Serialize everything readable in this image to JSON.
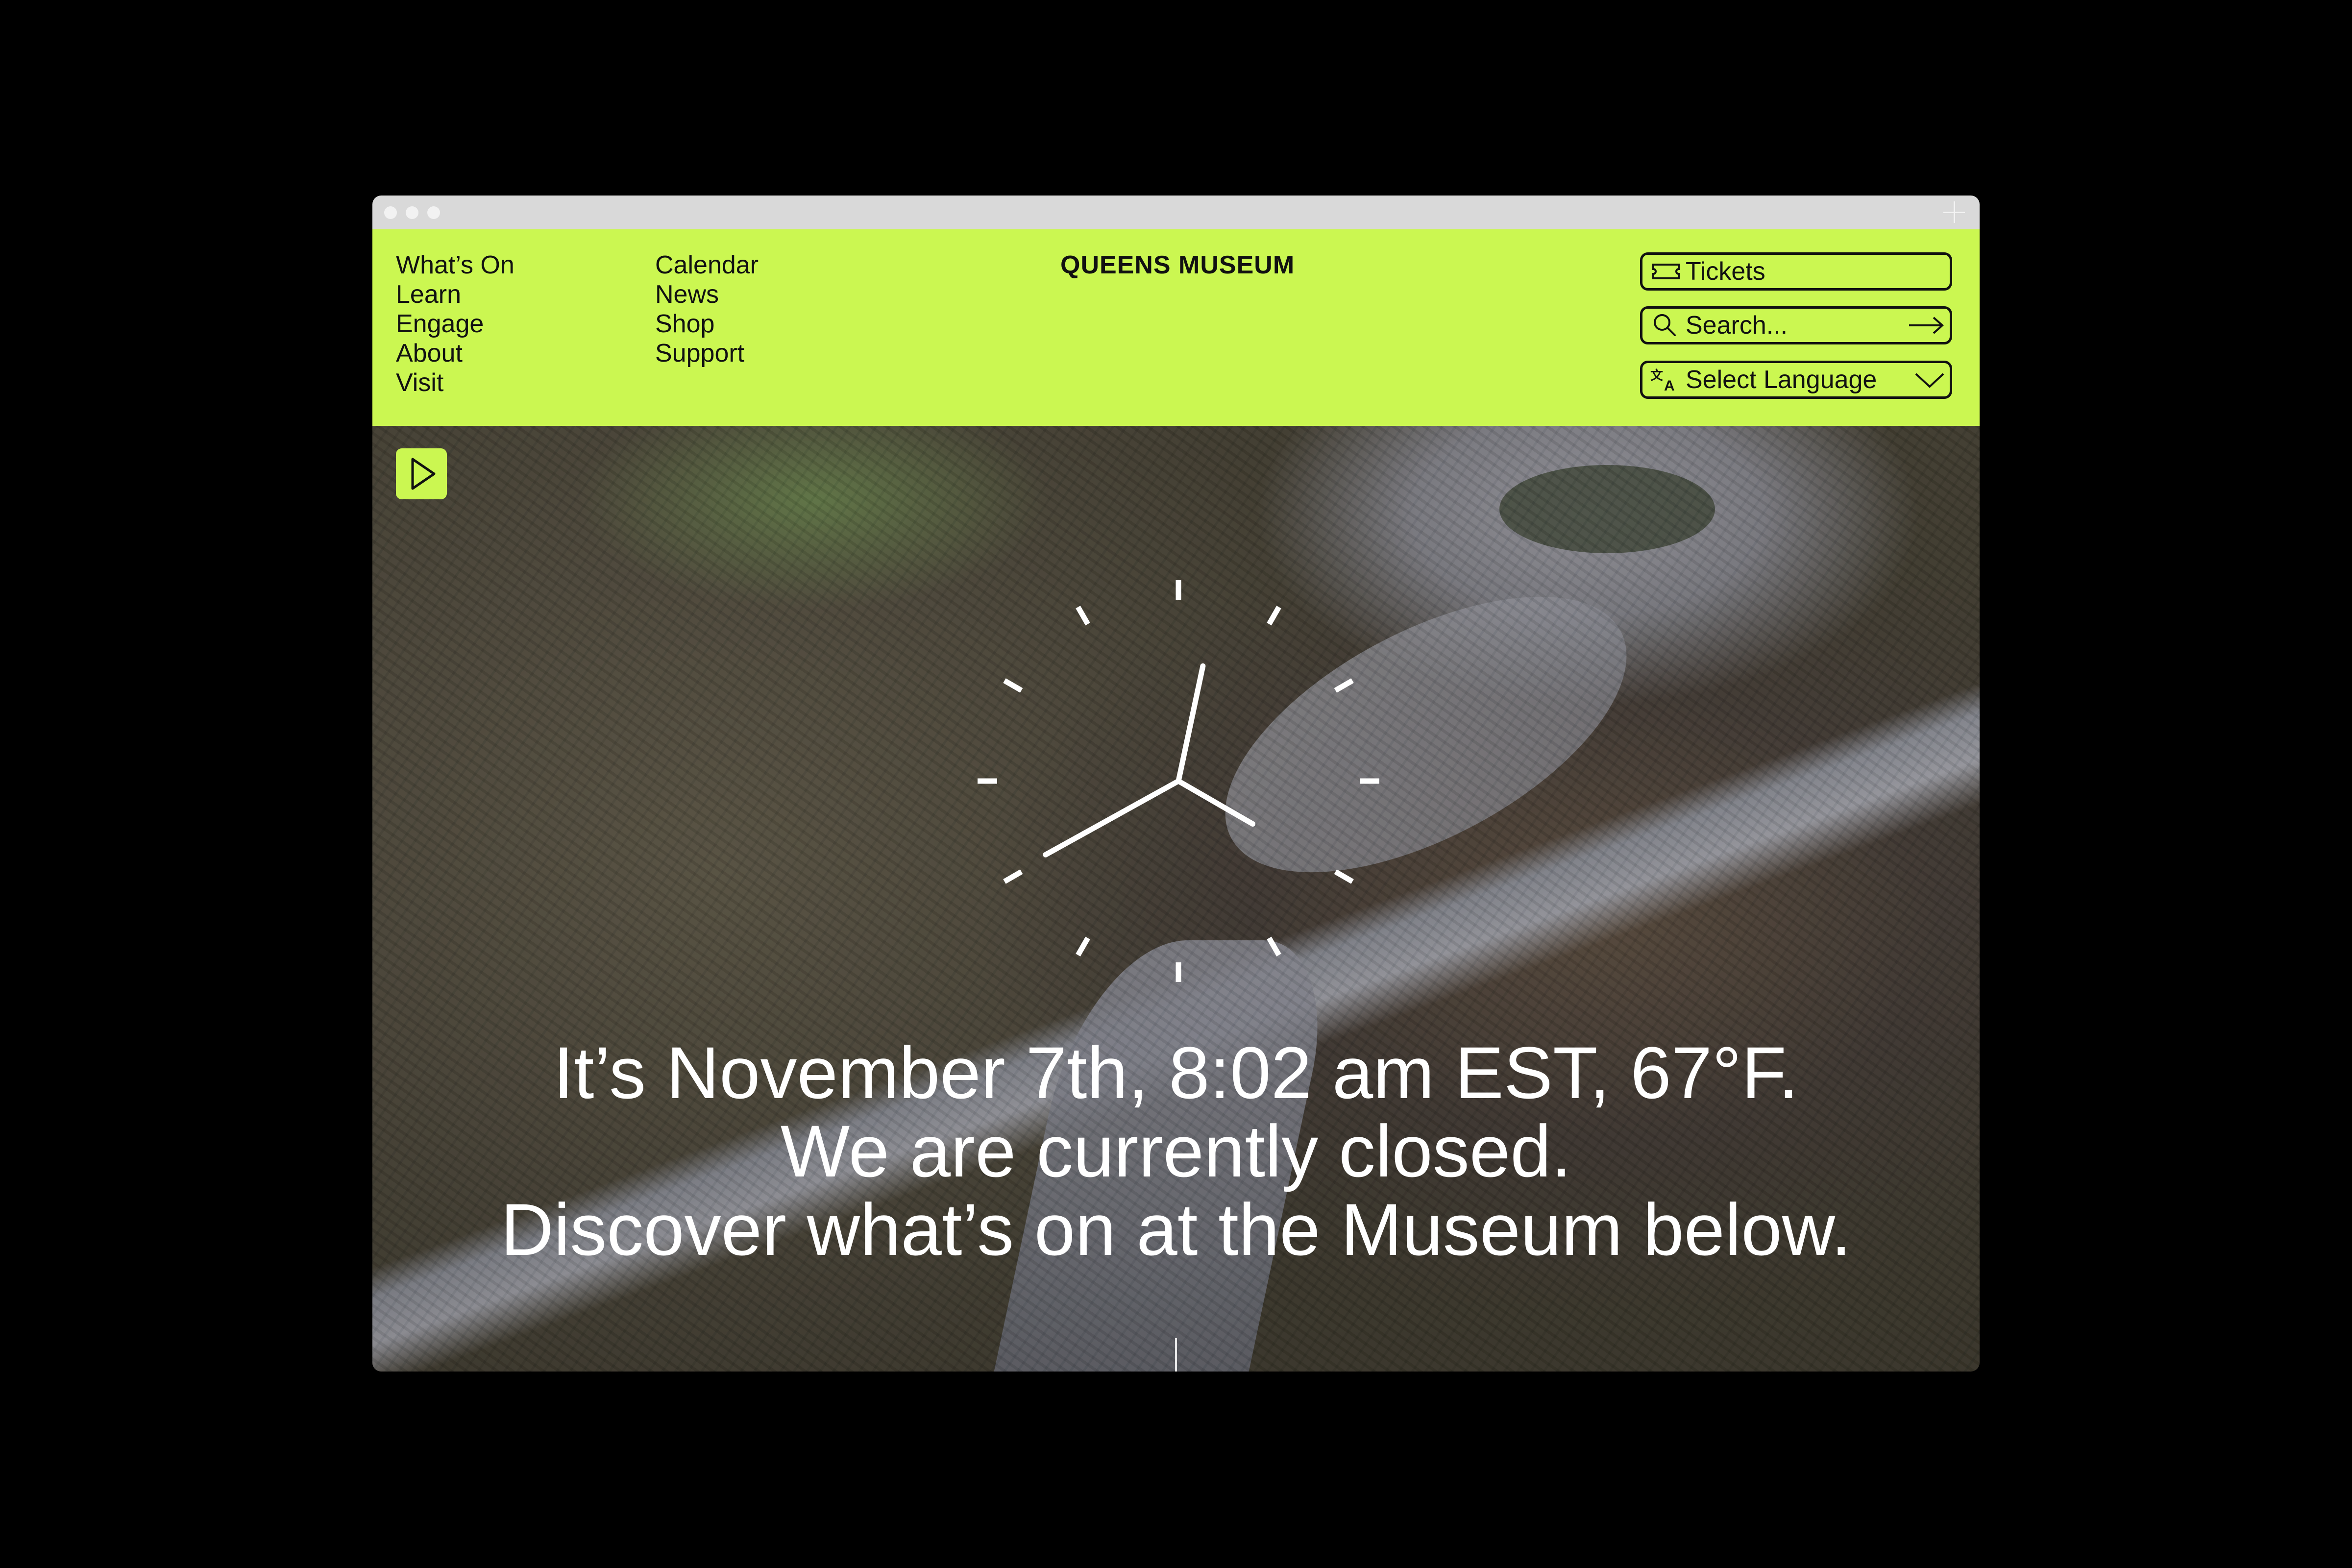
{
  "browser": {
    "controls": [
      "close",
      "minimize",
      "maximize"
    ],
    "new_tab_icon": "plus-icon"
  },
  "header": {
    "brand_color": "#cbf751",
    "logo": "QUEENS MUSEUM",
    "nav_primary": [
      "What’s On",
      "Learn",
      "Engage",
      "About",
      "Visit"
    ],
    "nav_secondary": [
      "Calendar",
      "News",
      "Shop",
      "Support"
    ],
    "tickets_label": "Tickets",
    "search_placeholder": "Search...",
    "language_label": "Select Language"
  },
  "hero": {
    "background": "aerial photograph of panorama model of New York City",
    "play_icon": "play-icon",
    "clock": {
      "hour": 8,
      "minute": 2
    },
    "message_lines": [
      "It’s November 7th, 8:02 am EST, 67°F.",
      "We are currently closed.",
      "Discover what’s on at the Museum below."
    ]
  }
}
